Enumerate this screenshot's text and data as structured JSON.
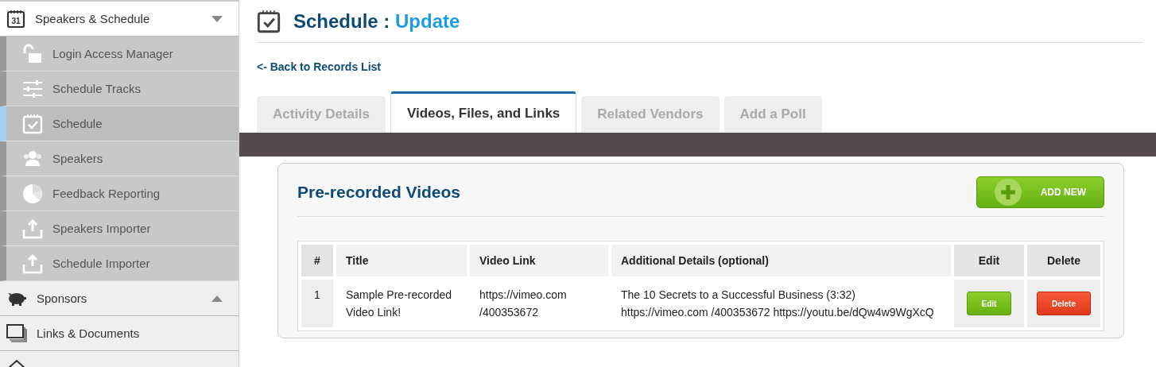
{
  "sidebar": {
    "items": [
      {
        "label": "Speakers & Schedule",
        "icon_text": "31",
        "expanded": true,
        "children": [
          {
            "label": "Login Access Manager",
            "selected": false
          },
          {
            "label": "Schedule Tracks",
            "selected": false
          },
          {
            "label": "Schedule",
            "selected": true
          },
          {
            "label": "Speakers",
            "selected": false
          },
          {
            "label": "Feedback Reporting",
            "selected": false
          },
          {
            "label": "Speakers Importer",
            "selected": false
          },
          {
            "label": "Schedule Importer",
            "selected": false
          }
        ]
      },
      {
        "label": "Sponsors",
        "expanded": false
      },
      {
        "label": "Links & Documents"
      }
    ]
  },
  "header": {
    "title": "Schedule",
    "separator": ":",
    "subtitle": "Update"
  },
  "back_link": "<- Back to Records List",
  "tabs": [
    {
      "label": "Activity Details",
      "selected": false
    },
    {
      "label": "Videos, Files, and Links",
      "selected": true
    },
    {
      "label": "Related Vendors",
      "selected": false
    },
    {
      "label": "Add a Poll",
      "selected": false
    }
  ],
  "panel": {
    "title": "Pre-recorded Videos",
    "add_button": "ADD NEW",
    "table": {
      "columns": [
        "#",
        "Title",
        "Video Link",
        "Additional Details (optional)",
        "Edit",
        "Delete"
      ],
      "rows": [
        {
          "number": "1",
          "title": "Sample Pre-recorded Video Link!",
          "video_link": "https://vimeo.com /400353672",
          "details": "The 10 Secrets to a Successful Business (3:32) https://vimeo.com /400353672 https://youtu.be/dQw4w9WgXcQ",
          "edit": "Edit",
          "delete": "Delete"
        }
      ]
    }
  }
}
